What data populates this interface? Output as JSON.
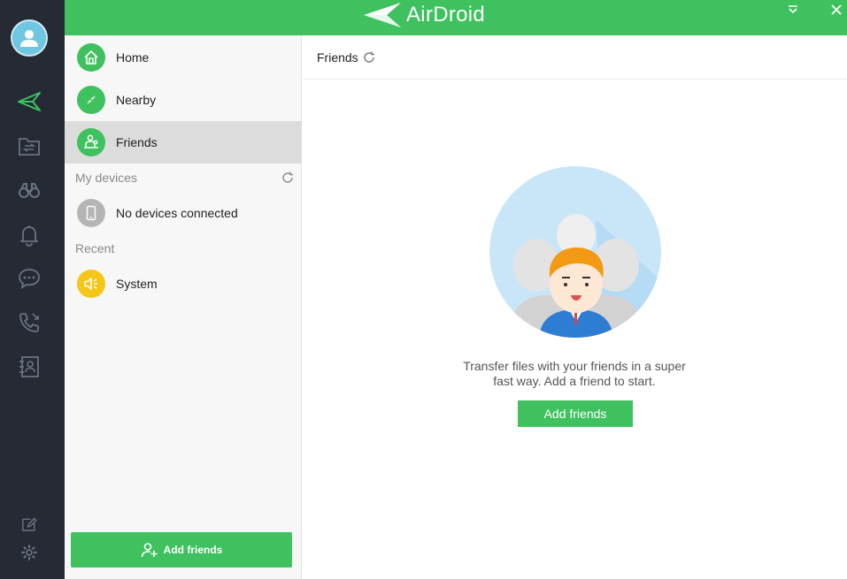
{
  "app": {
    "brand": "AirDroid",
    "accent": "#3fc15f",
    "rail_bg": "#252a35"
  },
  "rail": {
    "items": [
      {
        "icon": "send-icon",
        "active": true
      },
      {
        "icon": "file-transfer-icon"
      },
      {
        "icon": "binoculars-icon"
      },
      {
        "icon": "bell-icon"
      },
      {
        "icon": "chat-icon"
      },
      {
        "icon": "call-log-icon"
      },
      {
        "icon": "contacts-icon"
      }
    ],
    "bottom": [
      {
        "icon": "edit-icon"
      },
      {
        "icon": "gear-icon"
      }
    ]
  },
  "nav": {
    "items": [
      {
        "label": "Home",
        "icon": "home-icon"
      },
      {
        "label": "Nearby",
        "icon": "compass-icon"
      },
      {
        "label": "Friends",
        "icon": "friends-icon",
        "active": true
      }
    ],
    "my_devices_label": "My devices",
    "no_devices_label": "No devices connected",
    "recent_label": "Recent",
    "recent_items": [
      {
        "label": "System",
        "icon": "speaker-icon"
      }
    ],
    "add_friends_label": "Add friends"
  },
  "content": {
    "title": "Friends",
    "empty_line1": "Transfer files with your friends in a super",
    "empty_line2": "fast way. Add a friend to start.",
    "add_friends_label": "Add friends"
  }
}
